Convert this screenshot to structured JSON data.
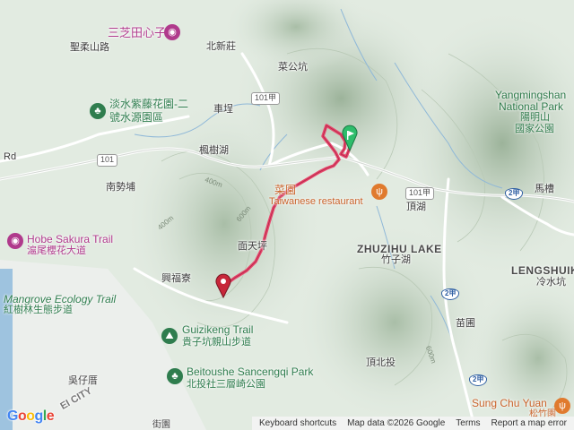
{
  "map": {
    "route_color": "#e8456b",
    "water_color": "#8fb8d8",
    "road_color": "#f3f3f3",
    "start_marker_color": "#2ebd6b",
    "end_marker_color": "#c7273a"
  },
  "labels": {
    "sanzhitian": "三芝田心子",
    "shengmi": "聖柔山路",
    "beixinzhuang": "北新莊",
    "caigongkeng": "菜公坑",
    "tamsui_wisteria": "淡水紫藤花園-二",
    "water_park": "號水源園區",
    "chepeng": "車埕",
    "fengshuhu": "楓樹湖",
    "rd": "Rd",
    "nanshipu": "南勢埔",
    "hobe_en": "Hobe Sakura Trail",
    "hobe_zh": "滬尾櫻花大道",
    "mianshuping": "面天坪",
    "xingfuliao": "興福寮",
    "mangrove_en": "Mangrove Ecology Trail",
    "mangrove_zh": "紅樹林生態步道",
    "guizikeng_en": "Guizikeng Trail",
    "guizikeng_zh": "貴子坑親山步道",
    "beitoushe_en": "Beitoushe Sancengqi Park",
    "beitoushe_zh": "北投社三層崎公園",
    "wuziping": "吳仔厝",
    "city": "EI CITY",
    "restaurant_en": "Taiwanese restaurant",
    "restaurant_zh": "菜園",
    "dinghu": "頂湖",
    "zhuzihu_en": "ZHUZIHU LAKE",
    "zhuzihu_zh": "竹子湖",
    "lengshuikeng_en": "LENGSHUIK",
    "lengshuikeng_zh": "冷水坑",
    "yangming_en_1": "Yangmingshan",
    "yangming_en_2": "National Park",
    "yangming_zh_1": "陽明山",
    "yangming_zh_2": "國家公園",
    "macao": "馬槽",
    "miaopu": "苗圃",
    "dingbeitou": "頂北投",
    "sungchuyuan_en": "Sung Chu Yuan",
    "sungchuyuan_zh": "松竹園",
    "jiejie": "街園"
  },
  "routes": {
    "r101_a": "101甲",
    "r101_b": "101甲",
    "r101_c": "101",
    "r2_a": "2甲",
    "r2_b": "2甲",
    "r2_c": "2甲"
  },
  "elevations": {
    "e1": "400m",
    "e2": "600m",
    "e3": "400m",
    "e4": "600m"
  },
  "footer": {
    "shortcuts": "Keyboard shortcuts",
    "mapdata": "Map data ©2026 Google",
    "terms": "Terms",
    "report": "Report a map error"
  },
  "brand": {
    "logo": "Google"
  },
  "icons": {
    "pink_poi": "camera-icon",
    "green_poi": "tree-icon",
    "restaurant": "fork-knife-icon",
    "start": "start-flag-marker-icon",
    "end": "end-pin-marker-icon"
  }
}
